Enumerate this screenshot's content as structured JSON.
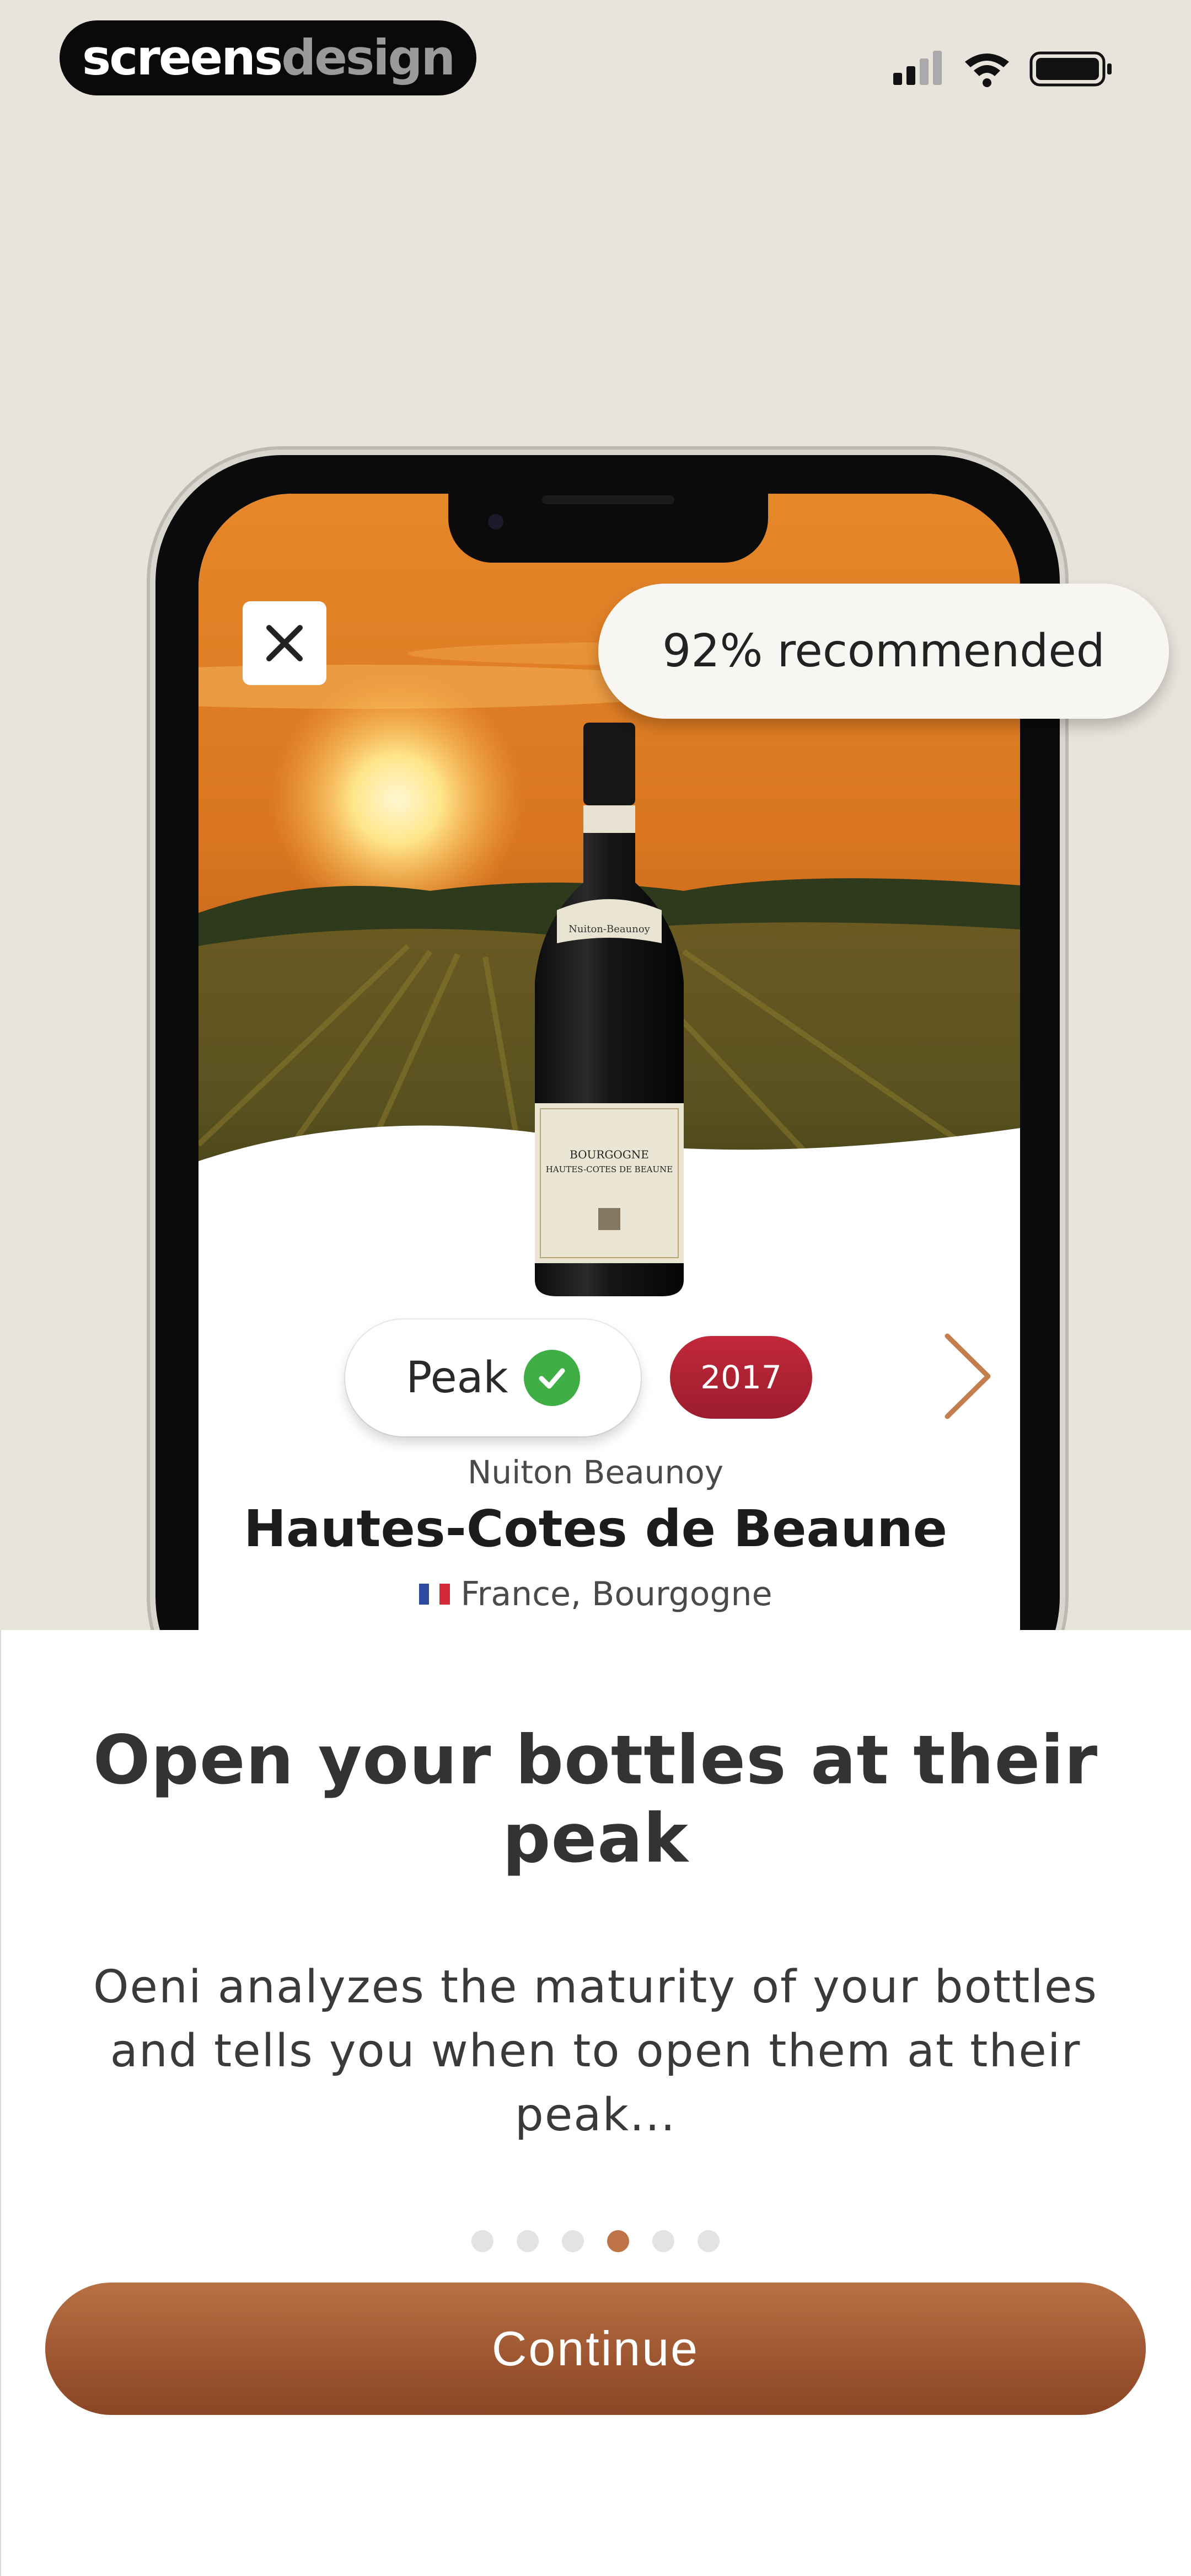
{
  "status_bar": {
    "brand_part1": "screens",
    "brand_part2": "design",
    "signal_icon": "cellular-signal-icon",
    "wifi_icon": "wifi-icon",
    "battery_icon": "battery-icon"
  },
  "mockup": {
    "recommendation": "92% recommended",
    "close_icon": "close-icon",
    "status_label": "Peak",
    "status_icon": "check-circle-icon",
    "vintage": "2017",
    "next_icon": "chevron-right-icon",
    "producer": "Nuiton Beaunoy",
    "wine_name": "Hautes-Cotes de Beaune",
    "region": "France, Bourgogne",
    "bottle_label": {
      "neck": "Nuiton-Beaunoy",
      "line1": "BOURGOGNE",
      "line2": "HAUTES-COTES DE BEAUNE"
    }
  },
  "onboarding": {
    "title": "Open your bottles at their peak",
    "description": "Oeni analyzes the maturity of your bottles and tells you when to open them at their peak...",
    "page_index": 4,
    "page_count": 6,
    "continue_label": "Continue"
  },
  "colors": {
    "accent": "#a85e38",
    "active_dot": "#bf7448",
    "vintage_badge": "#b22233",
    "peak_check": "#3fae45",
    "background": "#e8e4dc"
  }
}
